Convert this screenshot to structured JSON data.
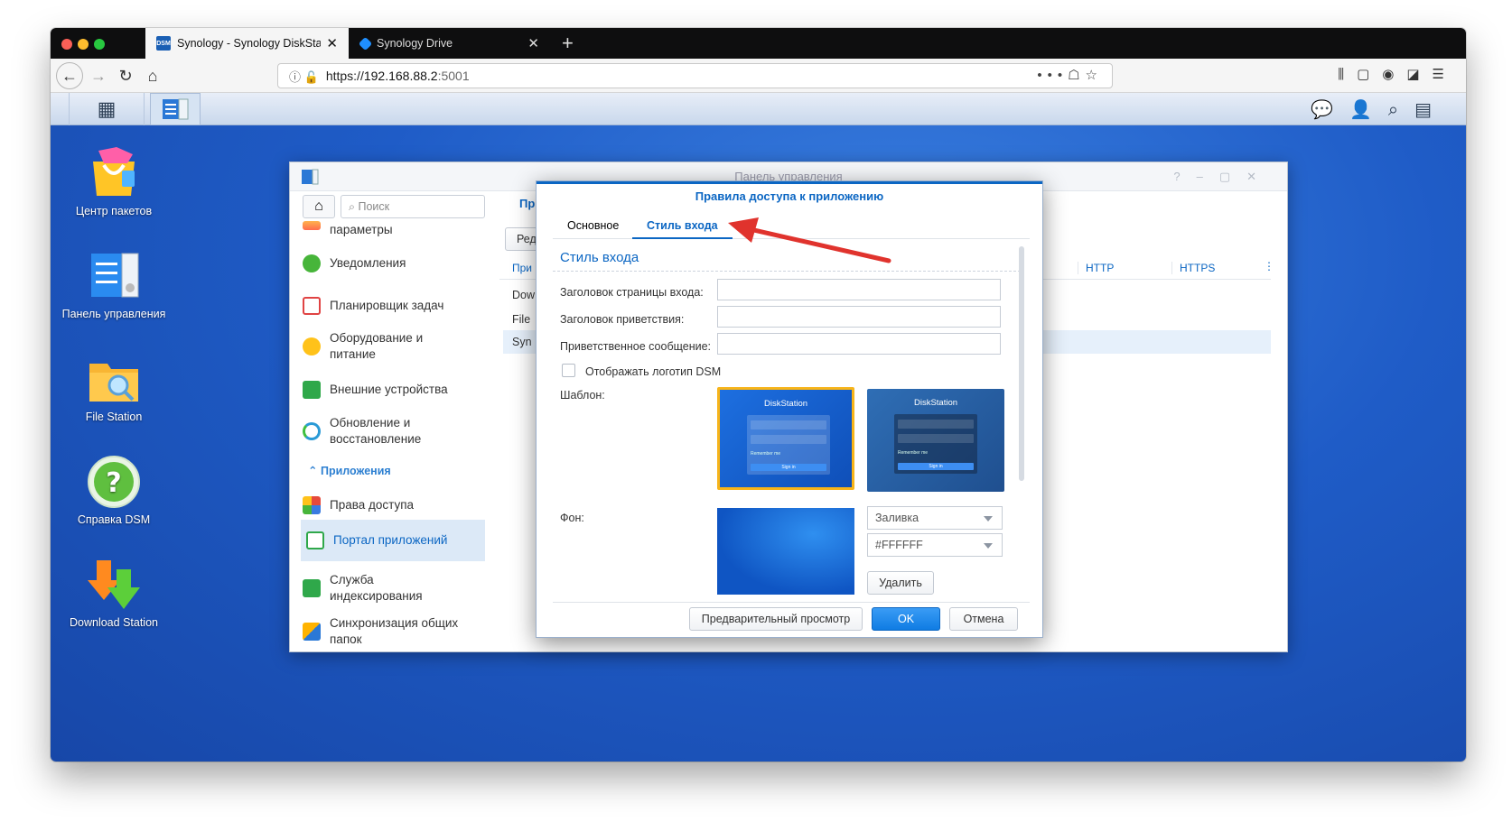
{
  "browser": {
    "tabs": [
      {
        "label": "Synology - Synology DiskStatio",
        "icon": "dsm-icon",
        "favicon_text": "DSM",
        "active": true
      },
      {
        "label": "Synology Drive",
        "icon": "drive-icon",
        "active": false
      }
    ],
    "url": {
      "scheme": "https://",
      "host": "192.168.88.2",
      "port": ":5001"
    }
  },
  "desktop": {
    "icons": [
      {
        "label": "Центр пакетов",
        "icon": "package-center-icon"
      },
      {
        "label": "Панель управления",
        "icon": "control-panel-icon"
      },
      {
        "label": "File Station",
        "icon": "file-station-icon"
      },
      {
        "label": "Справка DSM",
        "icon": "dsm-help-icon"
      },
      {
        "label": "Download Station",
        "icon": "download-station-icon"
      }
    ]
  },
  "control_panel": {
    "title": "Панель управления",
    "search_placeholder": "Поиск",
    "sidebar": {
      "items": [
        {
          "label": "параметры",
          "icon": "regional-options-icon"
        },
        {
          "label": "Уведомления",
          "icon": "notification-icon"
        },
        {
          "label": "Планировщик задач",
          "icon": "task-scheduler-icon"
        },
        {
          "label": "Оборудование и питание",
          "icon": "hardware-power-icon"
        },
        {
          "label": "Внешние устройства",
          "icon": "external-devices-icon"
        },
        {
          "label": "Обновление и восстановление",
          "icon": "update-restore-icon"
        },
        {
          "label": "Права доступа",
          "icon": "privileges-icon"
        },
        {
          "label": "Портал приложений",
          "icon": "application-portal-icon",
          "selected": true
        },
        {
          "label": "Служба индексирования",
          "icon": "indexing-service-icon"
        },
        {
          "label": "Синхронизация общих папок",
          "icon": "shared-folder-sync-icon"
        }
      ],
      "section_header": "Приложения"
    },
    "main": {
      "tab_partial": "Пр",
      "edit_partial": "Ред",
      "header_partial": "При",
      "rows_partial": [
        "Dow",
        "File",
        "Syn"
      ],
      "columns": [
        "HTTP",
        "HTTPS"
      ]
    }
  },
  "dialog": {
    "title": "Правила доступа к приложению",
    "tabs": [
      {
        "label": "Основное",
        "active": false
      },
      {
        "label": "Стиль входа",
        "active": true
      }
    ],
    "section_title": "Стиль входа",
    "fields": [
      {
        "label": "Заголовок страницы входа:",
        "value": ""
      },
      {
        "label": "Заголовок приветствия:",
        "value": ""
      },
      {
        "label": "Приветственное сообщение:",
        "value": ""
      }
    ],
    "show_logo_label": "Отображать логотип DSM",
    "show_logo_checked": false,
    "template_label": "Шаблон:",
    "templates": [
      {
        "title": "DiskStation",
        "signin": "Sign in",
        "remember": "Remember me",
        "selected": true
      },
      {
        "title": "DiskStation",
        "signin": "Sign in",
        "remember": "Remember me",
        "selected": false
      }
    ],
    "background_label": "Фон:",
    "background_fill": "Заливка",
    "background_color": "#FFFFFF",
    "delete_label": "Удалить",
    "buttons": {
      "preview": "Предварительный просмотр",
      "ok": "OK",
      "cancel": "Отмена"
    }
  },
  "colors": {
    "accent": "#0b66c3",
    "annotation_arrow": "#e0332d"
  }
}
